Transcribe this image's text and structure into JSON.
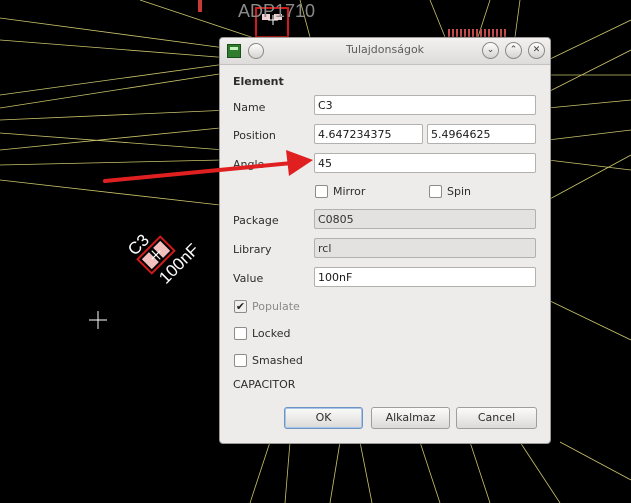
{
  "canvas": {
    "component_name": "ADP1710",
    "part_ref": "C3",
    "part_value": "100nF",
    "colors": {
      "wire": "#c9c46a",
      "pad": "#d11a1a",
      "arrow": "#e02020"
    }
  },
  "dialog": {
    "title": "Tulajdonságok",
    "section": "Element",
    "name_label": "Name",
    "name_value": "C3",
    "position_label": "Position",
    "position_x": "4.647234375",
    "position_y": "5.4964625",
    "angle_label": "Angle",
    "angle_value": "45",
    "mirror_label": "Mirror",
    "spin_label": "Spin",
    "package_label": "Package",
    "package_value": "C0805",
    "library_label": "Library",
    "library_value": "rcl",
    "value_label": "Value",
    "value_value": "100nF",
    "populate_label": "Populate",
    "locked_label": "Locked",
    "smashed_label": "Smashed",
    "description": "CAPACITOR",
    "ok_label": "OK",
    "apply_label": "Alkalmaz",
    "cancel_label": "Cancel",
    "check_mark": "✔",
    "window_buttons": {
      "minimize": "⌄",
      "maximize": "⌃",
      "close": "✕"
    }
  }
}
